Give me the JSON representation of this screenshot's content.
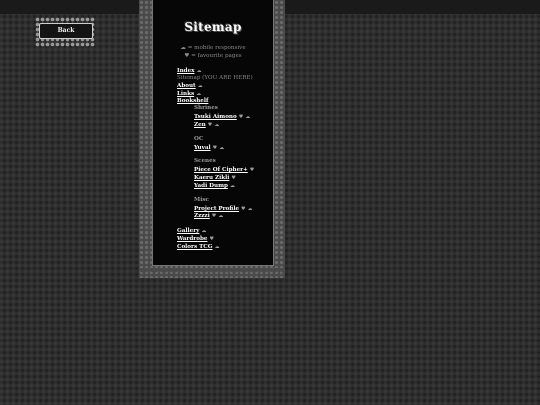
{
  "back": {
    "label": "Back"
  },
  "page": {
    "title": "Sitemap"
  },
  "legend": {
    "responsive_icon": "cloud-icon",
    "responsive_text": "= mobile responsive",
    "favorite_icon": "heart-icon",
    "favorite_text": "= favourite pages"
  },
  "nav": {
    "index": "Index",
    "sitemap": "Sitemap (YOU ARE HERE)",
    "about": "About",
    "links": "Links",
    "bookshelf": "Bookshelf"
  },
  "shrines": {
    "label": "Shrines",
    "items": [
      "Tsuki Aimono",
      "Zen"
    ]
  },
  "oc": {
    "label": "OC",
    "items": [
      "Yuval"
    ]
  },
  "scenes": {
    "label": "Scenes",
    "items": [
      "Piece Of Cipher+",
      "Kaeru Zikli",
      "Yadi Dump"
    ]
  },
  "misc": {
    "label": "Misc",
    "items": [
      "Project Profile",
      "Zzzzi"
    ]
  },
  "bottom": {
    "gallery": "Gallery",
    "wardrobe": "Wardrobe",
    "colors": "Colors TCG"
  },
  "glyphs": {
    "cloud": "☁",
    "heart": "♥"
  }
}
